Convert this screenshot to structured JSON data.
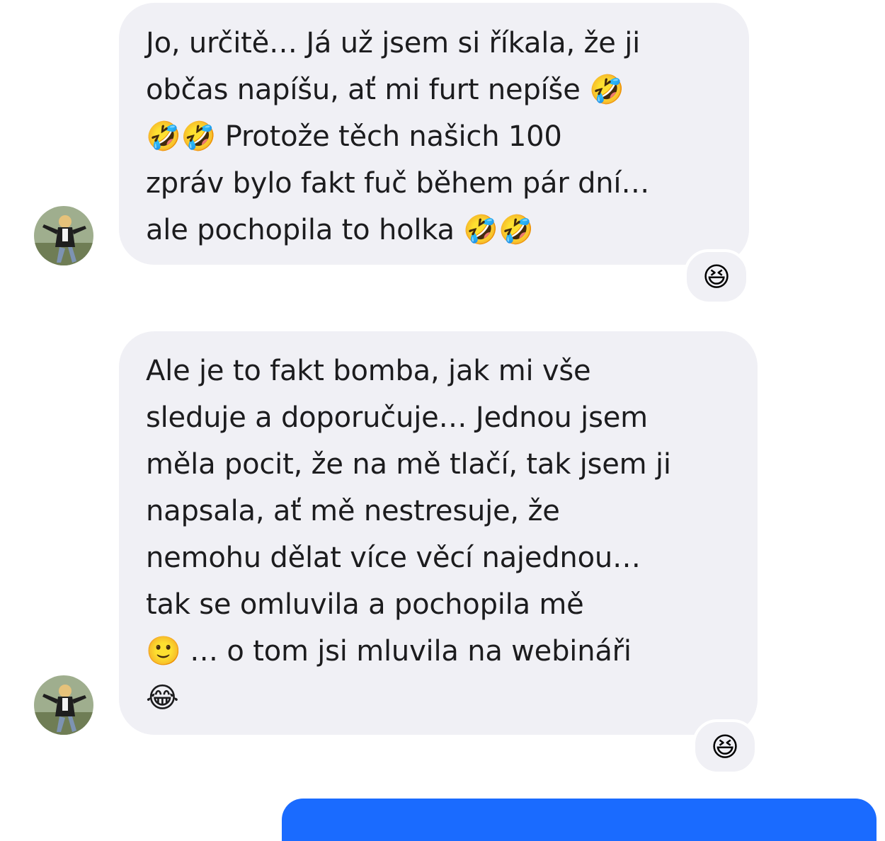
{
  "messages": [
    {
      "lines": [
        "Jo, určitě… Já už jsem si říkala, že ji",
        "občas napíšu, ať mi furt nepíše 🤣",
        "🤣🤣 Protože těch našich 100",
        "zpráv bylo fakt fuč během pár dní…",
        "ale pochopila to holka 🤣🤣"
      ],
      "reaction": "😆"
    },
    {
      "lines": [
        "Ale je to fakt bomba, jak mi vše",
        "sleduje a doporučuje… Jednou jsem",
        "měla pocit, že na mě tlačí, tak jsem ji",
        "napsala, ať mě nestresuje, že",
        "nemohu dělat více věcí najednou…",
        "tak se omluvila a pochopila mě",
        "🙂 … o tom jsi mluvila na webináři",
        "😂"
      ],
      "reaction": "😆"
    }
  ],
  "colors": {
    "incoming_bubble": "#f0f0f5",
    "outgoing_bubble": "#1a6bff",
    "text": "#1c1c1e"
  }
}
